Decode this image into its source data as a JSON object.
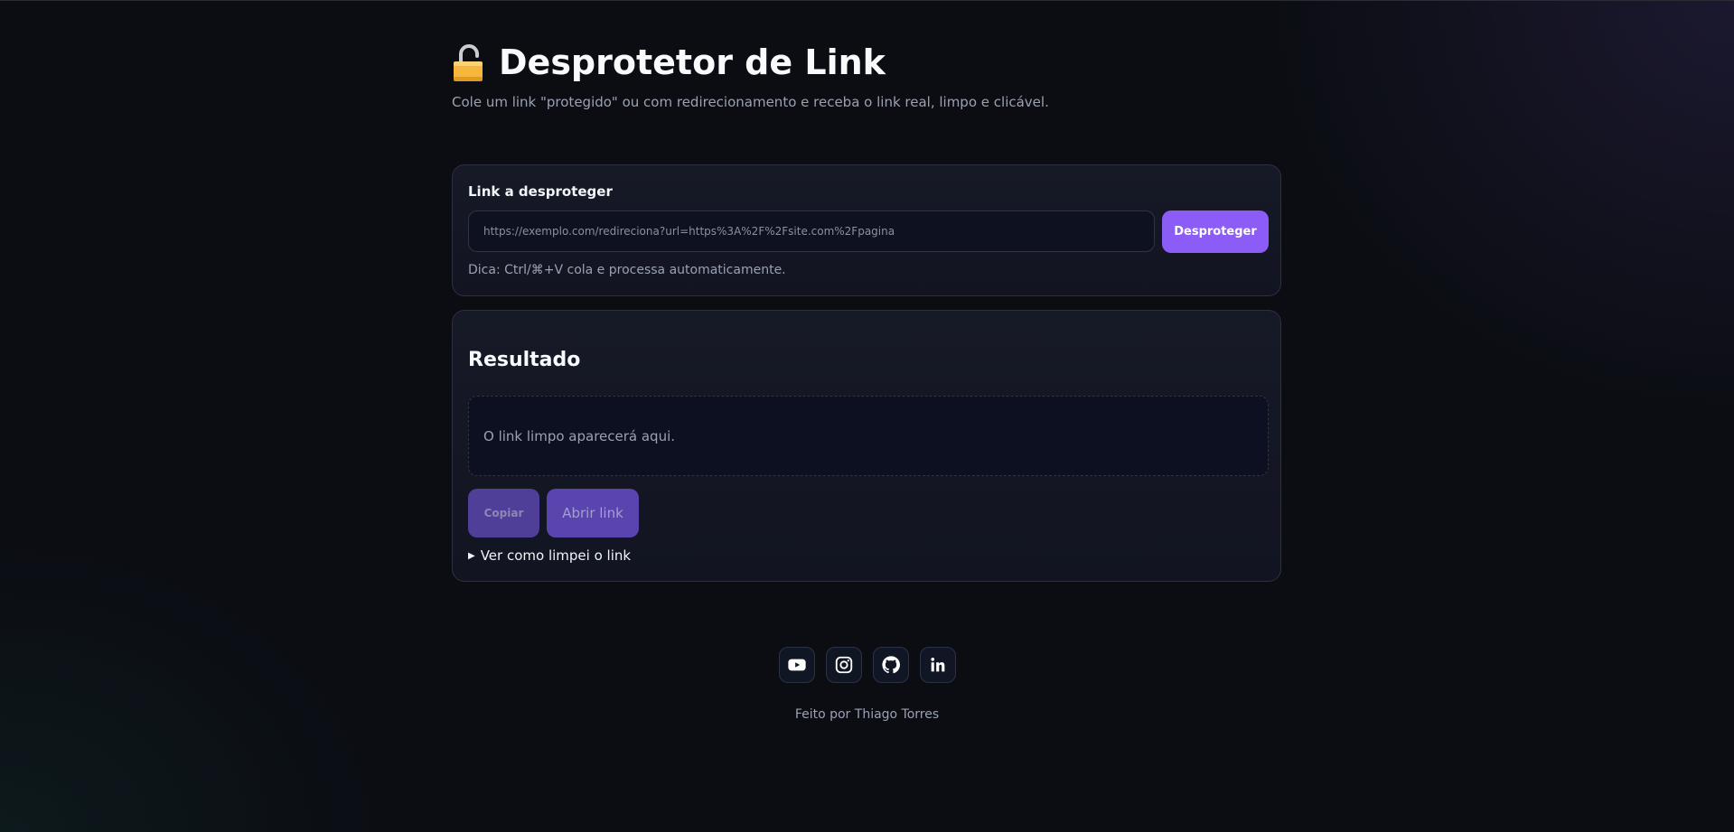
{
  "header": {
    "title": "Desprotetor de Link",
    "lock_icon": "unlocked-padlock-icon",
    "subtitle": "Cole um link \"protegido\" ou com redirecionamento e receba o link real, limpo e clicável."
  },
  "input_card": {
    "label": "Link a desproteger",
    "input_value": "",
    "input_placeholder": "https://exemplo.com/redireciona?url=https%3A%2F%2Fsite.com%2Fpagina",
    "button_label": "Desproteger",
    "hint": "Dica: Ctrl/⌘+V cola e processa automaticamente."
  },
  "result_card": {
    "title": "Resultado",
    "placeholder": "O link limpo aparecerá aqui.",
    "copy_label": "Copiar",
    "open_label": "Abrir link",
    "details_label": "Ver como limpei o link"
  },
  "footer": {
    "socials": [
      {
        "icon": "youtube-icon"
      },
      {
        "icon": "instagram-icon"
      },
      {
        "icon": "github-icon"
      },
      {
        "icon": "linkedin-icon"
      }
    ],
    "credit": "Feito por Thiago Torres"
  },
  "colors": {
    "background": "#0b0d13",
    "card": "#151926",
    "accent": "#8b5cf6",
    "accent_disabled": "#4f3f99"
  }
}
